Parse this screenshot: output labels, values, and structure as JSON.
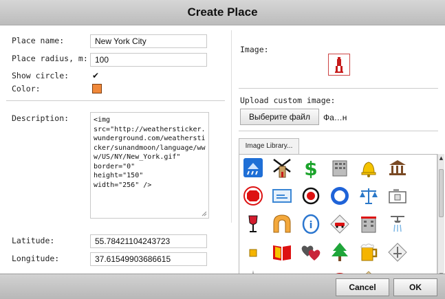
{
  "dialog": {
    "title": "Create Place"
  },
  "form": {
    "place_name_label": "Place name:",
    "place_name_value": "New York City",
    "radius_label": "Place radius, m:",
    "radius_value": "100",
    "show_circle_label": "Show circle:",
    "show_circle_checked": true,
    "color_label": "Color:",
    "color_value": "#f0883a",
    "description_label": "Description:",
    "description_value": "<img\nsrc=\"http://weathersticker.wunderground.com/weathersticker/sunandmoon/language/www/US/NY/New_York.gif\"\nborder=\"0\"\nheight=\"150\"\nwidth=\"256\" />",
    "latitude_label": "Latitude:",
    "latitude_value": "55.78421104243723",
    "longitude_label": "Longitude:",
    "longitude_value": "37.61549903686615"
  },
  "right": {
    "image_label": "Image:",
    "upload_label": "Upload custom image:",
    "file_button": "Выберите файл",
    "file_name": "Фа…н",
    "library_tab": "Image Library..."
  },
  "icons": [
    "weather-rain-icon",
    "mill-icon",
    "dollar-icon",
    "building-icon",
    "bell-icon",
    "museum-icon",
    "stop-sign-icon",
    "info-sign-icon",
    "record-icon",
    "circle-icon",
    "scales-icon",
    "camera-icon",
    "wine-glass-icon",
    "arch-icon",
    "info-circle-icon",
    "car-sign-icon",
    "hotel-icon",
    "shower-icon",
    "small-square-icon",
    "book-icon",
    "hearts-icon",
    "tree-icon",
    "beer-icon",
    "compass-icon",
    "airplane-icon",
    "people-icon",
    "person-icon",
    "phone-icon",
    "house-icon",
    "bus-icon"
  ],
  "footer": {
    "cancel": "Cancel",
    "ok": "OK"
  }
}
